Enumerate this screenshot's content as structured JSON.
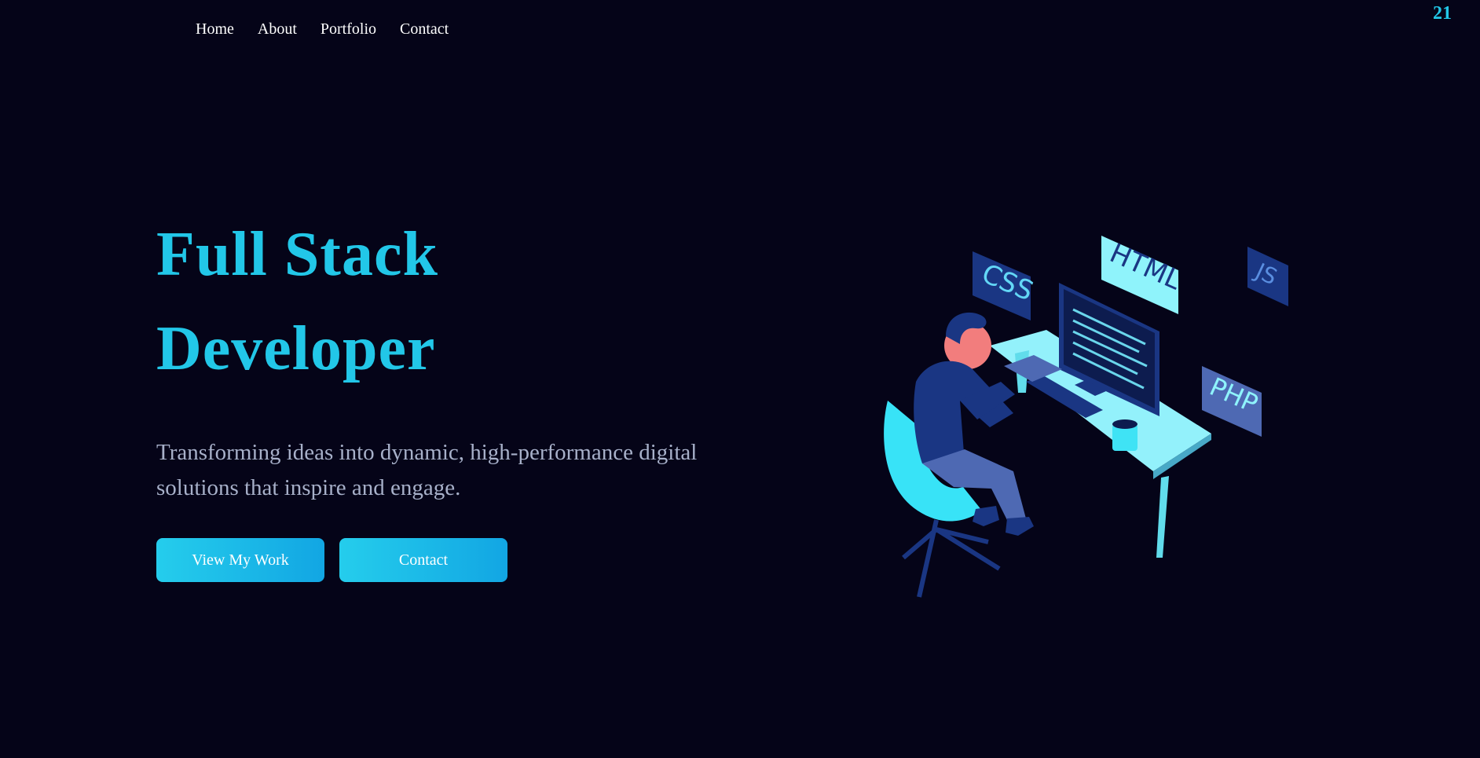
{
  "nav": {
    "items": [
      {
        "label": "Home"
      },
      {
        "label": "About"
      },
      {
        "label": "Portfolio"
      },
      {
        "label": "Contact"
      }
    ]
  },
  "corner_number": "21",
  "hero": {
    "title_line1": "Full Stack",
    "title_line2": "Developer",
    "subtitle": "Transforming ideas into dynamic, high-performance digital solutions that inspire and engage.",
    "buttons": {
      "view_work": "View My Work",
      "contact": "Contact"
    }
  },
  "illustration": {
    "tags": {
      "css": "CSS",
      "html": "HTML",
      "js": "JS",
      "php": "PHP"
    }
  },
  "colors": {
    "background": "#050418",
    "accent": "#22c7e8",
    "subtitle": "#a7b0c9",
    "button_gradient_start": "#25cdec",
    "button_gradient_end": "#12a6e3"
  }
}
